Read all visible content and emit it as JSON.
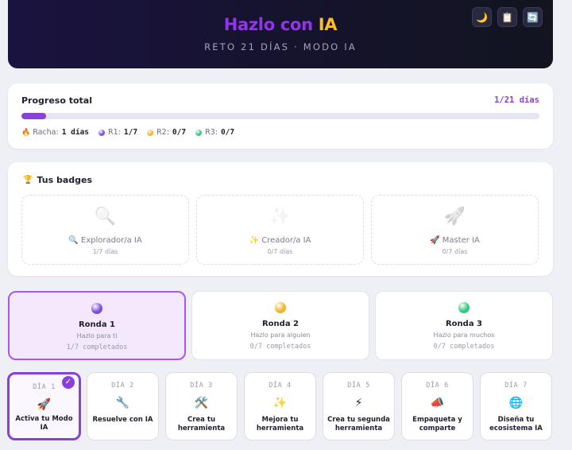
{
  "header": {
    "title_part1": "Hazlo con",
    "title_part2": "IA",
    "subtitle": "RETO 21 DÍAS · MODO IA",
    "buttons": [
      {
        "icon": "moon-icon",
        "glyph": "🌙"
      },
      {
        "icon": "clipboard-icon",
        "glyph": "📋"
      },
      {
        "icon": "refresh-icon",
        "glyph": "🔄"
      }
    ]
  },
  "progress": {
    "title": "Progreso total",
    "count": "1/21 días",
    "fraction": 0.0476,
    "stats": [
      {
        "label": "Racha:",
        "value": "1 días",
        "icon": "fire-icon",
        "glyph": "🔥"
      },
      {
        "label": "R1:",
        "value": "1/7",
        "color": "#7c4ddb"
      },
      {
        "label": "R2:",
        "value": "0/7",
        "color": "#f0b429"
      },
      {
        "label": "R3:",
        "value": "0/7",
        "color": "#34c77b"
      }
    ]
  },
  "badges": {
    "title": "Tus badges",
    "title_glyph": "🏆",
    "items": [
      {
        "big": "🔍",
        "name": "🔍 Explorador/a IA",
        "days": "1/7 días",
        "icon": "magnifier-icon"
      },
      {
        "big": "✨",
        "name": "✨ Creador/a IA",
        "days": "0/7 días",
        "icon": "sparkles-icon"
      },
      {
        "big": "🚀",
        "name": "🚀 Master IA",
        "days": "0/7 días",
        "icon": "rocket-icon"
      }
    ]
  },
  "rounds": [
    {
      "name": "Ronda 1",
      "subtitle": "Hazlo para ti",
      "done": "1/7 completados",
      "color": "#7c4ddb"
    },
    {
      "name": "Ronda 2",
      "subtitle": "Hazlo para alguien",
      "done": "0/7 completados",
      "color": "#f0b429"
    },
    {
      "name": "Ronda 3",
      "subtitle": "Hazlo para muchos",
      "done": "0/7 completados",
      "color": "#34c77b"
    }
  ],
  "days": [
    {
      "num": "DÍA 1",
      "glyph": "🚀",
      "icon": "rocket-icon",
      "name": "Activa tu Modo IA",
      "check": "✓"
    },
    {
      "num": "DÍA 2",
      "glyph": "🔧",
      "icon": "wrench-icon",
      "name": "Resuelve con IA"
    },
    {
      "num": "DÍA 3",
      "glyph": "🛠️",
      "icon": "tools-icon",
      "name": "Crea tu herramienta"
    },
    {
      "num": "DÍA 4",
      "glyph": "✨",
      "icon": "sparkles-icon",
      "name": "Mejora tu herramienta"
    },
    {
      "num": "DÍA 5",
      "glyph": "⚡",
      "icon": "lightning-icon",
      "name": "Crea tu segunda herramienta"
    },
    {
      "num": "DÍA 6",
      "glyph": "📣",
      "icon": "megaphone-icon",
      "name": "Empaqueta y comparte"
    },
    {
      "num": "DÍA 7",
      "glyph": "🌐",
      "icon": "globe-icon",
      "name": "Diseña tu ecosistema IA"
    }
  ]
}
